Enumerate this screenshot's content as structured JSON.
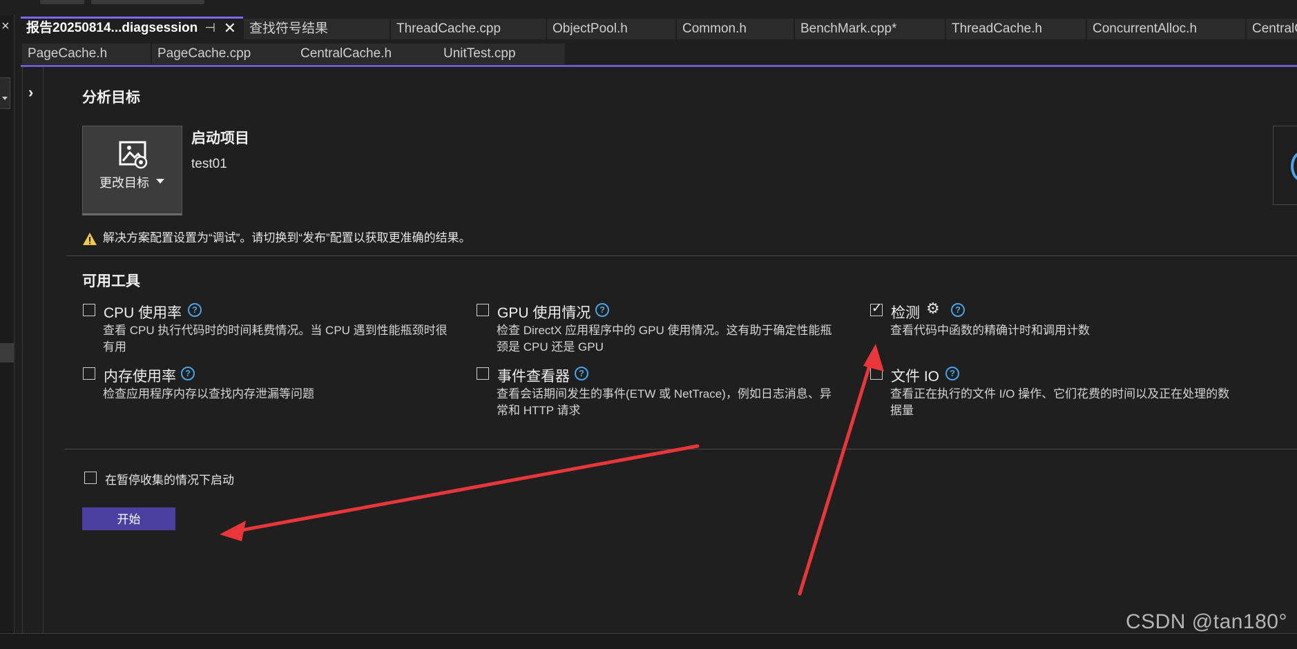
{
  "tabs_row1": [
    {
      "label": "报告20250814...diagsession",
      "active": true
    },
    {
      "label": "查找符号结果"
    },
    {
      "label": "ThreadCache.cpp"
    },
    {
      "label": "ObjectPool.h"
    },
    {
      "label": "Common.h"
    },
    {
      "label": "BenchMark.cpp*"
    },
    {
      "label": "ThreadCache.h"
    },
    {
      "label": "ConcurrentAlloc.h"
    },
    {
      "label": "CentralCac"
    }
  ],
  "tabs_row2": [
    {
      "label": "PageCache.h"
    },
    {
      "label": "PageCache.cpp"
    },
    {
      "label": "CentralCache.h"
    },
    {
      "label": "UnitTest.cpp"
    }
  ],
  "tab_icons": {
    "pin": "⊣",
    "close": "✕"
  },
  "target": {
    "section_title": "分析目标",
    "change_button_label": "更改目标",
    "project_heading": "启动项目",
    "project_name": "test01",
    "warning": "解决方案配置设置为“调试”。请切换到“发布”配置以获取更准确的结果。"
  },
  "tools": {
    "section_title": "可用工具",
    "items": [
      {
        "name": "CPU 使用率",
        "checked": false,
        "desc_line1": "查看 CPU 执行代码时的时间耗费情况。当 CPU 遇到性能瓶颈时很",
        "desc_line2": "有用"
      },
      {
        "name": "GPU 使用情况",
        "checked": false,
        "desc_line1": "检查 DirectX 应用程序中的 GPU 使用情况。这有助于确定性能瓶",
        "desc_line2": "颈是 CPU 还是 GPU"
      },
      {
        "name": "检测",
        "checked": true,
        "desc_line1": "查看代码中函数的精确计时和调用计数",
        "desc_line2": ""
      },
      {
        "name": "内存使用率",
        "checked": false,
        "desc_line1": "检查应用程序内存以查找内存泄漏等问题",
        "desc_line2": ""
      },
      {
        "name": "事件查看器",
        "checked": false,
        "desc_line1": "查看会话期间发生的事件(ETW 或 NetTrace)，例如日志消息、异",
        "desc_line2": "常和 HTTP 请求"
      },
      {
        "name": "文件 IO",
        "checked": false,
        "desc_line1": "查看正在执行的文件 I/O 操作、它们花费的时间以及正在处理的数",
        "desc_line2": "据量"
      }
    ],
    "help_glyph": "?",
    "gear_glyph": "⚙"
  },
  "start_paused_label": "在暂停收集的情况下启动",
  "start_button_label": "开始",
  "watermark": "CSDN @tan180°",
  "colors": {
    "accent": "#6a5acd",
    "start_button": "#4b3fa0",
    "help": "#4aa3e8",
    "annotation_arrow": "#e8363a"
  }
}
